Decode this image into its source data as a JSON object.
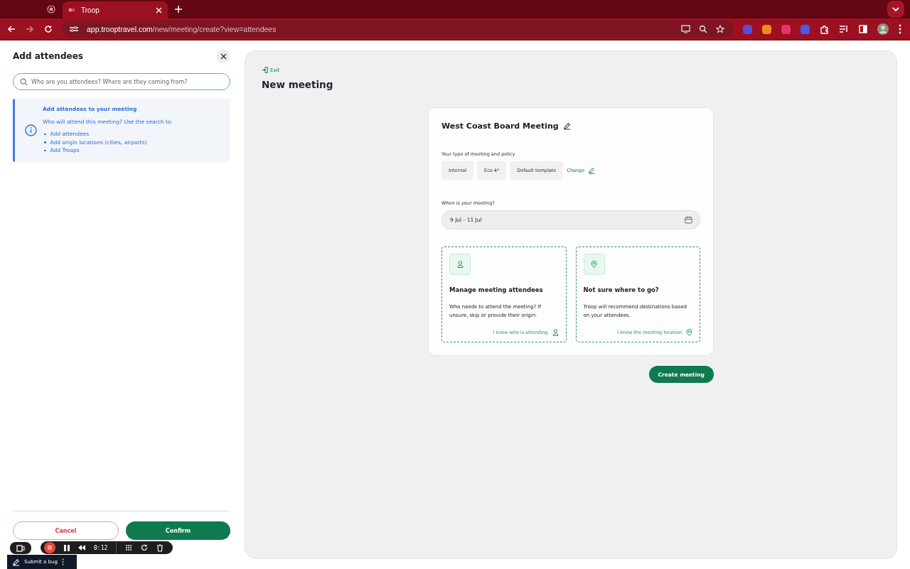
{
  "browser": {
    "tabs": [
      {
        "title": "Troop",
        "selected": true
      }
    ],
    "url_host": "app.trooptravel.com",
    "url_path": "/new/meeting/create?view=attendees"
  },
  "side_panel": {
    "title": "Add attendees",
    "search": {
      "placeholder": "Who are you attendees? Where are they coming from?"
    },
    "info": {
      "title": "Add attendees to your meeting",
      "text": "Who will attend this meeting? Use the search to:",
      "items": [
        "Add attendees",
        "Add origin locations (cities, airports)",
        "Add Troops"
      ]
    },
    "buttons": [
      {
        "label": "Cancel",
        "kind": "outline"
      },
      {
        "label": "Confirm",
        "kind": "primary"
      }
    ]
  },
  "main": {
    "exit": "Exit",
    "title": "New meeting",
    "card": {
      "name": "West Coast Board Meeting",
      "policy_label": "Your type of meeting and policy",
      "policy_chips": [
        "Internal",
        "Eco 4*",
        "Default template"
      ],
      "change": "Change",
      "date_label": "When is your meeting?",
      "date_value": "9 Jul - 11 Jul",
      "options": [
        {
          "kind": "person",
          "title": "Manage meeting attendees",
          "text": "Who needs to attend the meeting? If unsure, skip or provide their origin.",
          "link": "I know who is attending"
        },
        {
          "kind": "pin",
          "title": "Not sure where to go?",
          "text": "Troop will recommend destinations based on your attendees.",
          "link": "I know the meeting location"
        }
      ]
    },
    "create": "Create meeting"
  },
  "recorder": {
    "time": "0:12",
    "bug": "Submit a bug"
  }
}
